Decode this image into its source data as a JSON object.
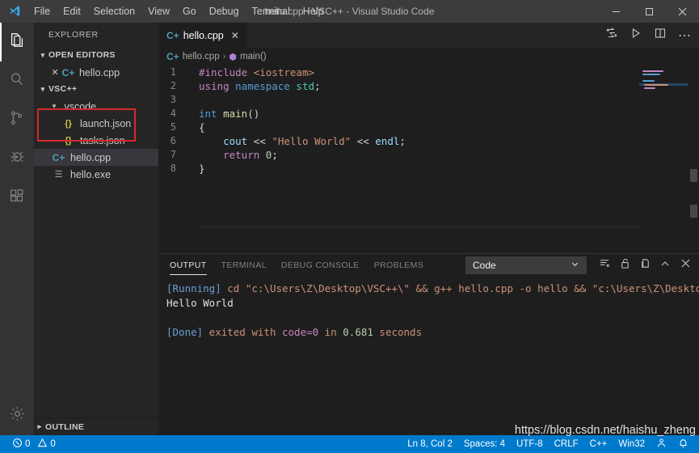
{
  "titlebar": {
    "logo_icon": "vscode-logo-icon",
    "title": "hello.cpp - VSC++ - Visual Studio Code",
    "menus": [
      "File",
      "Edit",
      "Selection",
      "View",
      "Go",
      "Debug",
      "Terminal",
      "Help"
    ],
    "window_controls": [
      {
        "name": "minimize-button",
        "glyph": "─"
      },
      {
        "name": "maximize-button",
        "glyph": "☐"
      },
      {
        "name": "close-button",
        "glyph": "✕"
      }
    ]
  },
  "activitybar": {
    "items": [
      {
        "name": "explorer",
        "icon": "files-icon",
        "active": true
      },
      {
        "name": "search",
        "icon": "search-icon",
        "active": false
      },
      {
        "name": "source-control",
        "icon": "source-control-icon",
        "active": false
      },
      {
        "name": "debug",
        "icon": "debug-icon",
        "active": false
      },
      {
        "name": "extensions",
        "icon": "extensions-icon",
        "active": false
      }
    ],
    "bottom": [
      {
        "name": "manage",
        "icon": "gear-icon"
      }
    ]
  },
  "sidebar": {
    "title": "EXPLORER",
    "open_editors": {
      "label": "OPEN EDITORS",
      "expanded": true,
      "items": [
        {
          "label": "hello.cpp",
          "icon": "cpp-file-icon",
          "close": "✕"
        }
      ]
    },
    "workspace": {
      "label": "VSC++",
      "expanded": true,
      "items": [
        {
          "label": ".vscode",
          "icon": "folder-icon",
          "kind": "folder",
          "indent": 1,
          "expanded": true
        },
        {
          "label": "launch.json",
          "icon": "json-file-icon",
          "kind": "file",
          "indent": 2,
          "highlighted": true
        },
        {
          "label": "tasks.json",
          "icon": "json-file-icon",
          "kind": "file",
          "indent": 2,
          "highlighted": true
        },
        {
          "label": "hello.cpp",
          "icon": "cpp-file-icon",
          "kind": "file",
          "indent": 1,
          "selected": true
        },
        {
          "label": "hello.exe",
          "icon": "binary-file-icon",
          "kind": "file",
          "indent": 1
        }
      ]
    },
    "outline": {
      "label": "OUTLINE",
      "expanded": false
    },
    "annotation_color": "#d42b2b"
  },
  "editor": {
    "tabs": [
      {
        "label": "hello.cpp",
        "icon": "cpp-file-icon",
        "active": true,
        "close": "✕"
      }
    ],
    "actions": [
      {
        "name": "run-code-button",
        "icon": "run-code-icon"
      },
      {
        "name": "run-button",
        "icon": "play-icon"
      },
      {
        "name": "split-editor-button",
        "icon": "split-editor-icon"
      },
      {
        "name": "more-actions-button",
        "icon": "ellipsis-icon"
      }
    ],
    "breadcrumb": [
      {
        "label": "hello.cpp",
        "icon": "cpp-file-icon"
      },
      {
        "label": "main()",
        "icon": "symbol-method-icon"
      }
    ],
    "breadcrumb_separator": "›",
    "lines": [
      {
        "n": "1",
        "tokens": [
          {
            "t": "#include ",
            "c": "t-pre"
          },
          {
            "t": "<iostream>",
            "c": "t-str"
          }
        ]
      },
      {
        "n": "2",
        "tokens": [
          {
            "t": "using ",
            "c": "t-kw2"
          },
          {
            "t": "namespace ",
            "c": "t-kw"
          },
          {
            "t": "std",
            "c": "t-type"
          },
          {
            "t": ";",
            "c": "t-plain"
          }
        ]
      },
      {
        "n": "3",
        "tokens": []
      },
      {
        "n": "4",
        "tokens": [
          {
            "t": "int ",
            "c": "t-kw"
          },
          {
            "t": "main",
            "c": "t-fn"
          },
          {
            "t": "()",
            "c": "t-plain"
          }
        ]
      },
      {
        "n": "5",
        "tokens": [
          {
            "t": "{",
            "c": "t-plain"
          }
        ]
      },
      {
        "n": "6",
        "tokens": [
          {
            "t": "    ",
            "c": "t-plain"
          },
          {
            "t": "cout ",
            "c": "t-var"
          },
          {
            "t": "<< ",
            "c": "t-op"
          },
          {
            "t": "\"Hello World\"",
            "c": "t-str"
          },
          {
            "t": " << ",
            "c": "t-op"
          },
          {
            "t": "endl",
            "c": "t-var"
          },
          {
            "t": ";",
            "c": "t-plain"
          }
        ]
      },
      {
        "n": "7",
        "tokens": [
          {
            "t": "    ",
            "c": "t-plain"
          },
          {
            "t": "return ",
            "c": "t-kw2"
          },
          {
            "t": "0",
            "c": "t-num"
          },
          {
            "t": ";",
            "c": "t-plain"
          }
        ]
      },
      {
        "n": "8",
        "tokens": [
          {
            "t": "}",
            "c": "t-plain"
          }
        ]
      }
    ]
  },
  "panel": {
    "tabs": [
      {
        "label": "OUTPUT",
        "active": true
      },
      {
        "label": "TERMINAL",
        "active": false
      },
      {
        "label": "DEBUG CONSOLE",
        "active": false
      },
      {
        "label": "PROBLEMS",
        "active": false
      }
    ],
    "channel_select": {
      "value": "Code",
      "chevron": "⌄"
    },
    "actions": [
      {
        "name": "clear-output-button",
        "icon": "clear-output-icon"
      },
      {
        "name": "lock-scroll-button",
        "icon": "unlock-icon"
      },
      {
        "name": "open-in-editor-button",
        "icon": "open-in-editor-icon"
      },
      {
        "name": "maximize-panel-button",
        "icon": "chevron-up-icon"
      },
      {
        "name": "close-panel-button",
        "icon": "close-icon"
      }
    ],
    "output": {
      "running_tag": "[Running]",
      "running_cmd": " cd \"c:\\Users\\Z\\Desktop\\VSC++\\\" && g++ hello.cpp -o hello && \"c:\\Users\\Z\\Desktop\\VSC+",
      "program_output": "Hello World",
      "done_tag": "[Done]",
      "done_text_1": " exited with ",
      "done_code": "code=0",
      "done_text_2": " in ",
      "done_seconds": "0.681",
      "done_text_3": " seconds"
    }
  },
  "statusbar": {
    "background": "#007acc",
    "left": [
      {
        "name": "error-count",
        "icon": "error-icon",
        "value": "0"
      },
      {
        "name": "warning-count",
        "icon": "warning-icon",
        "value": "0"
      }
    ],
    "right": [
      {
        "name": "cursor-position",
        "label": "Ln 8, Col 2"
      },
      {
        "name": "indentation",
        "label": "Spaces: 4"
      },
      {
        "name": "encoding",
        "label": "UTF-8"
      },
      {
        "name": "eol",
        "label": "CRLF"
      },
      {
        "name": "language-mode",
        "label": "C++"
      },
      {
        "name": "platform",
        "label": "Win32"
      },
      {
        "name": "feedback",
        "label": "☺"
      },
      {
        "name": "notifications",
        "label": "🔔"
      }
    ]
  },
  "watermark": {
    "text": "https://blog.csdn.net/haishu_zheng"
  }
}
